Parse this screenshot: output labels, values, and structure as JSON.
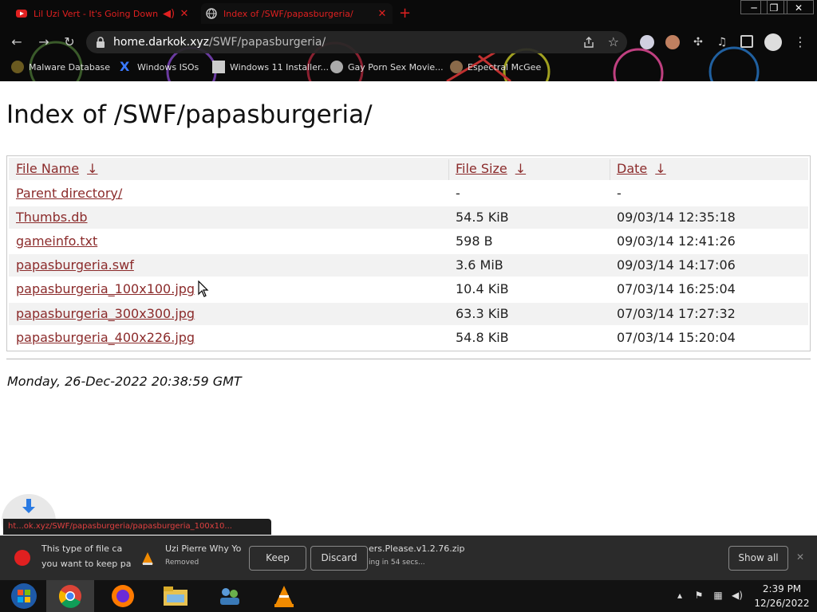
{
  "browser": {
    "tabs": [
      {
        "title": "Lil Uzi Vert - It's Going Down",
        "favicon": "youtube-icon"
      },
      {
        "title": "Index of /SWF/papasburgeria/",
        "favicon": "globe-icon"
      }
    ],
    "new_tab": "+",
    "url_host": "home.darkok.xyz",
    "url_path": "/SWF/papasburgeria/",
    "bookmarks": [
      "Malware Database",
      "Windows ISOs",
      "Windows 11 Installer...",
      "Gay Porn Sex Movie...",
      "Espectral McGee"
    ],
    "accent_color": "#e02020"
  },
  "page": {
    "title": "Index of /SWF/papasburgeria/",
    "columns": {
      "name": "File Name",
      "size": "File Size",
      "date": "Date",
      "sort_arrow": "↓"
    },
    "rows": [
      {
        "name": "Parent directory/",
        "size": "-",
        "date": "-"
      },
      {
        "name": "Thumbs.db",
        "size": "54.5 KiB",
        "date": "09/03/14 12:35:18"
      },
      {
        "name": "gameinfo.txt",
        "size": "598 B",
        "date": "09/03/14 12:41:26"
      },
      {
        "name": "papasburgeria.swf",
        "size": "3.6 MiB",
        "date": "09/03/14 14:17:06"
      },
      {
        "name": "papasburgeria_100x100.jpg",
        "size": "10.4 KiB",
        "date": "07/03/14 16:25:04"
      },
      {
        "name": "papasburgeria_300x300.jpg",
        "size": "63.3 KiB",
        "date": "07/03/14 17:27:32"
      },
      {
        "name": "papasburgeria_400x226.jpg",
        "size": "54.8 KiB",
        "date": "07/03/14 15:20:04"
      }
    ],
    "footer_date": "Monday, 26-Dec-2022 20:38:59 GMT",
    "link_color": "#8b2b2b"
  },
  "status_bar": {
    "url": "ht...ok.xyz/SWF/papasburgeria/papasburgeria_100x10..."
  },
  "downloads": {
    "warning_line1": "This type of file ca",
    "warning_line2": "you want to keep pa",
    "item2_name": "Uzi Pierre Why Yo",
    "item2_status": "Removed",
    "item3_name": "ers.Please.v1.2.76.zip",
    "item3_status": "ing in 54 secs...",
    "keep_label": "Keep",
    "discard_label": "Discard",
    "show_all_label": "Show all"
  },
  "taskbar": {
    "apps": [
      "start-orb-icon",
      "chrome-icon",
      "firefox-icon",
      "file-explorer-icon",
      "network-users-icon",
      "vlc-icon"
    ],
    "time": "2:39 PM",
    "date": "12/26/2022"
  }
}
